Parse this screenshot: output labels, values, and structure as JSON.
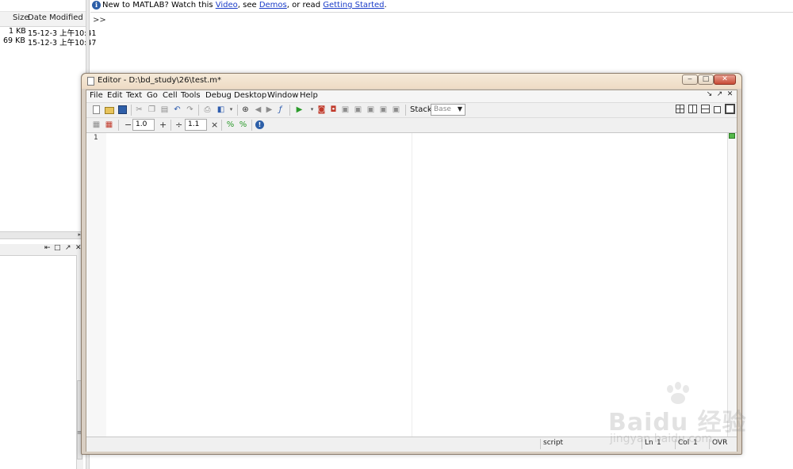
{
  "left_panel": {
    "columns": [
      "Size",
      "Date Modified"
    ],
    "files": [
      {
        "size": "1 KB",
        "date": "15-12-3 上午10:41"
      },
      {
        "size": "69 KB",
        "date": "15-12-3 上午10:47"
      }
    ],
    "split_arrow": "▸",
    "workspace_controls": [
      "⇤",
      "□",
      "↗",
      "✕"
    ]
  },
  "command_window": {
    "info_prefix": "New to MATLAB? Watch this ",
    "link_video": "Video",
    "sep1": ", see ",
    "link_demos": "Demos",
    "sep2": ", or read ",
    "link_getting_started": "Getting Started",
    "suffix": ".",
    "prompt": ">>"
  },
  "editor": {
    "title": "Editor - D:\\bd_study\\26\\test.m*",
    "window_controls": {
      "minimize": "‒",
      "maximize": "□",
      "close": "✕"
    },
    "menu": [
      "File",
      "Edit",
      "Text",
      "Go",
      "Cell",
      "Tools",
      "Debug",
      "Desktop",
      "Window",
      "Help"
    ],
    "menu_right": [
      "↘",
      "↗",
      "✕"
    ],
    "toolbar": {
      "stack_label": "Stack:",
      "stack_value": "Base"
    },
    "cell_toolbar": {
      "minus": "−",
      "value1": "1.0",
      "plus": "+",
      "divide": "÷",
      "value2": "1.1",
      "times": "×"
    },
    "line_numbers": [
      "1"
    ],
    "status": {
      "mode": "script",
      "ln_label": "Ln",
      "ln_value": "1",
      "col_label": "Col",
      "col_value": "1",
      "ovr": "OVR"
    }
  },
  "watermark": {
    "logo": "Baidu 经验",
    "url": "jingyan.baidu.com"
  },
  "colors": {
    "editor_frame": "#d9cfc3",
    "link": "#1a3cc8",
    "indicator_green": "#55b94b"
  }
}
